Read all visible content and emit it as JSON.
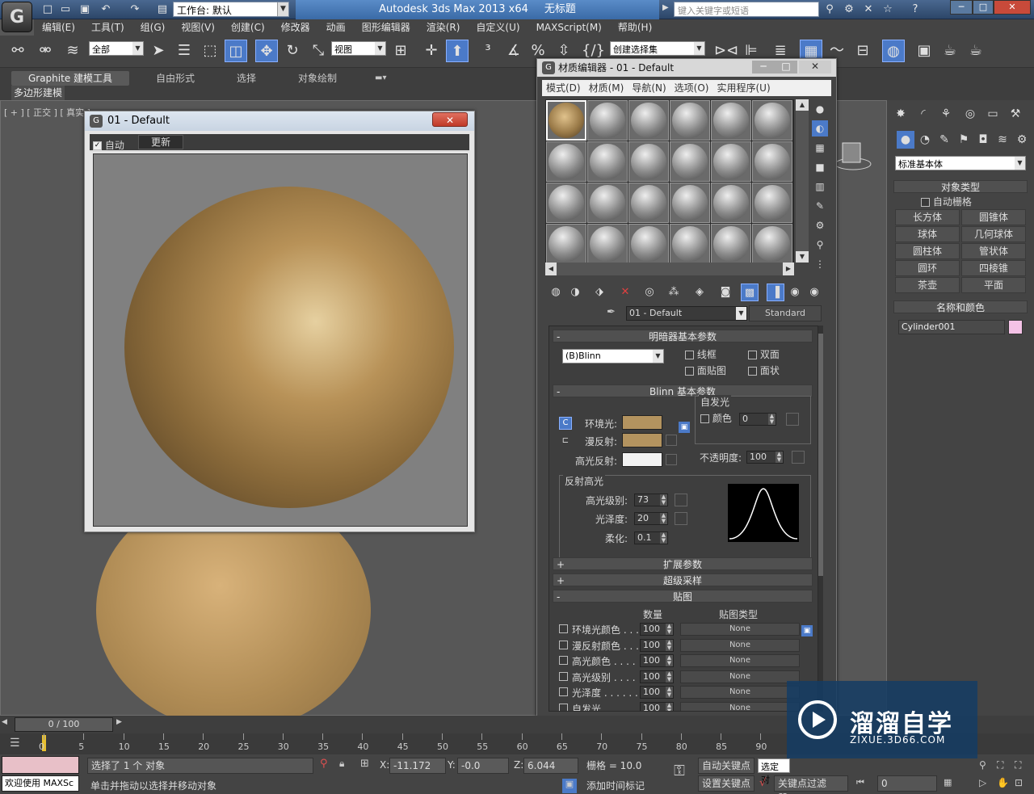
{
  "titlebar": {
    "workspace_label": "工作台: 默认",
    "app_title": "Autodesk 3ds Max  2013 x64",
    "doc_title": "无标题",
    "search_placeholder": "键入关键字或短语"
  },
  "menubar": [
    "编辑(E)",
    "工具(T)",
    "组(G)",
    "视图(V)",
    "创建(C)",
    "修改器",
    "动画",
    "图形编辑器",
    "渲染(R)",
    "自定义(U)",
    "MAXScript(M)",
    "帮助(H)"
  ],
  "toolbar": {
    "selection_filter": "全部",
    "ref_coord": "视图",
    "sel_set": "创建选择集"
  },
  "ribbon": {
    "tabs": [
      "Graphite 建模工具",
      "自由形式",
      "选择",
      "对象绘制"
    ],
    "panel_label": "多边形建模"
  },
  "viewport": {
    "label": "[ + ] [ 正交 ] [ 真实 ]"
  },
  "preview_window": {
    "title": "01 - Default",
    "auto_label": "自动",
    "update_label": "更新"
  },
  "material_editor": {
    "title": "材质编辑器 - 01 - Default",
    "menu": [
      "模式(D)",
      "材质(M)",
      "导航(N)",
      "选项(O)",
      "实用程序(U)"
    ],
    "material_name": "01 - Default",
    "material_type": "Standard",
    "shader_rollout": "明暗器基本参数",
    "shader": "(B)Blinn",
    "wire": "线框",
    "two_sided": "双面",
    "face_map": "面贴图",
    "faceted": "面状",
    "blinn_rollout": "Blinn 基本参数",
    "self_illum": "自发光",
    "color": "颜色",
    "self_illum_value": "0",
    "ambient": "环境光:",
    "diffuse": "漫反射:",
    "specular": "高光反射:",
    "opacity_label": "不透明度:",
    "opacity_value": "100",
    "spec_highlights": "反射高光",
    "spec_level_label": "高光级别:",
    "spec_level": "73",
    "gloss_label": "光泽度:",
    "gloss": "20",
    "soften_label": "柔化:",
    "soften": "0.1",
    "extended": "扩展参数",
    "supersampling": "超级采样",
    "maps_rollout": "贴图",
    "amount_header": "数量",
    "maptype_header": "贴图类型",
    "maps": [
      {
        "name": "环境光颜色 . . .",
        "amount": "100",
        "map": "None"
      },
      {
        "name": "漫反射颜色 . . .",
        "amount": "100",
        "map": "None"
      },
      {
        "name": "高光颜色 . . . .",
        "amount": "100",
        "map": "None"
      },
      {
        "name": "高光级别 . . . .",
        "amount": "100",
        "map": "None"
      },
      {
        "name": "光泽度 . . . . . .",
        "amount": "100",
        "map": "None"
      },
      {
        "name": "自发光 . . . . . .",
        "amount": "100",
        "map": "None"
      }
    ],
    "colors": {
      "ambient": "#b3935f",
      "diffuse": "#b3935f",
      "specular": "#f2f2f2"
    }
  },
  "command_panel": {
    "dropdown": "标准基本体",
    "object_type": "对象类型",
    "autogrid": "自动栅格",
    "buttons": [
      "长方体",
      "圆锥体",
      "球体",
      "几何球体",
      "圆柱体",
      "管状体",
      "圆环",
      "四棱锥",
      "茶壶",
      "平面"
    ],
    "name_color": "名称和颜色",
    "object_name": "Cylinder001",
    "object_color": "#f4c2e6"
  },
  "timeline": {
    "frame_counter": "0 / 100",
    "ticks": [
      "0",
      "5",
      "10",
      "15",
      "20",
      "25",
      "30",
      "35",
      "40",
      "45",
      "50",
      "55",
      "60",
      "65",
      "70",
      "75",
      "80",
      "85",
      "90"
    ]
  },
  "status": {
    "welcome": "欢迎使用 MAXSc",
    "selected": "选择了 1 个 对象",
    "prompt": "单击并拖动以选择并移动对象",
    "x_label": "X:",
    "x": "-11.172",
    "y_label": "Y:",
    "y": "-0.0",
    "z_label": "Z:",
    "z": "6.044",
    "grid": "栅格 = 10.0",
    "add_time_tag": "添加时间标记",
    "auto_key": "自动关键点",
    "set_key": "设置关键点",
    "selected_dropdown": "选定对",
    "key_filters": "关键点过滤器...",
    "frame_field": "0"
  },
  "watermark": {
    "brand": "溜溜自学",
    "url": "ZIXUE.3D66.COM"
  }
}
